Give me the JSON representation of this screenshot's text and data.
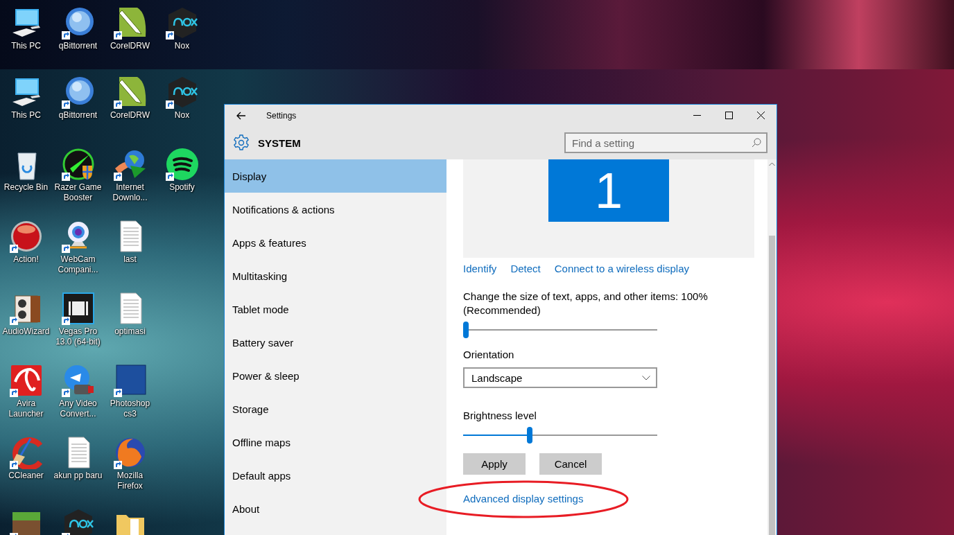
{
  "desktop_top_strip": {
    "icons": [
      {
        "label": "This PC"
      },
      {
        "label": "qBittorrent"
      },
      {
        "label": "CorelDRW"
      },
      {
        "label": "Nox"
      }
    ]
  },
  "desktop": {
    "icon_rows": [
      [
        {
          "label": "This PC"
        },
        {
          "label": "qBittorrent"
        },
        {
          "label": "CorelDRW"
        },
        {
          "label": "Nox"
        }
      ],
      [
        {
          "label": "Recycle Bin"
        },
        {
          "label": "Razer Game Booster"
        },
        {
          "label": "Internet Downlo..."
        },
        {
          "label": "Spotify"
        }
      ],
      [
        {
          "label": "Action!"
        },
        {
          "label": "WebCam Compani..."
        },
        {
          "label": "last"
        }
      ],
      [
        {
          "label": "AudioWizard"
        },
        {
          "label": "Vegas Pro 13.0 (64-bit)"
        },
        {
          "label": "optimasi"
        }
      ],
      [
        {
          "label": "Avira Launcher"
        },
        {
          "label": "Any Video Convert..."
        },
        {
          "label": "Photoshop cs3"
        }
      ],
      [
        {
          "label": "CCleaner"
        },
        {
          "label": "akun pp baru"
        },
        {
          "label": "Mozilla Firefox"
        }
      ],
      [
        {},
        {},
        {}
      ]
    ]
  },
  "settings_window": {
    "title": "Settings",
    "header": "SYSTEM",
    "search": {
      "placeholder": "Find a setting"
    },
    "sidebar": {
      "items": [
        {
          "label": "Display",
          "selected": true
        },
        {
          "label": "Notifications & actions",
          "selected": false
        },
        {
          "label": "Apps & features",
          "selected": false
        },
        {
          "label": "Multitasking",
          "selected": false
        },
        {
          "label": "Tablet mode",
          "selected": false
        },
        {
          "label": "Battery saver",
          "selected": false
        },
        {
          "label": "Power & sleep",
          "selected": false
        },
        {
          "label": "Storage",
          "selected": false
        },
        {
          "label": "Offline maps",
          "selected": false
        },
        {
          "label": "Default apps",
          "selected": false
        },
        {
          "label": "About",
          "selected": false
        }
      ]
    },
    "display_preview": {
      "monitor_number": "1"
    },
    "links": [
      "Identify",
      "Detect",
      "Connect to a wireless display"
    ],
    "scale": {
      "label": "Change the size of text, apps, and other items: 100% (Recommended)",
      "level": 0
    },
    "orientation": {
      "label": "Orientation",
      "value": "Landscape"
    },
    "brightness": {
      "label": "Brightness level",
      "level": 0.34
    },
    "buttons": [
      "Apply",
      "Cancel"
    ],
    "advanced_link": "Advanced display settings"
  }
}
